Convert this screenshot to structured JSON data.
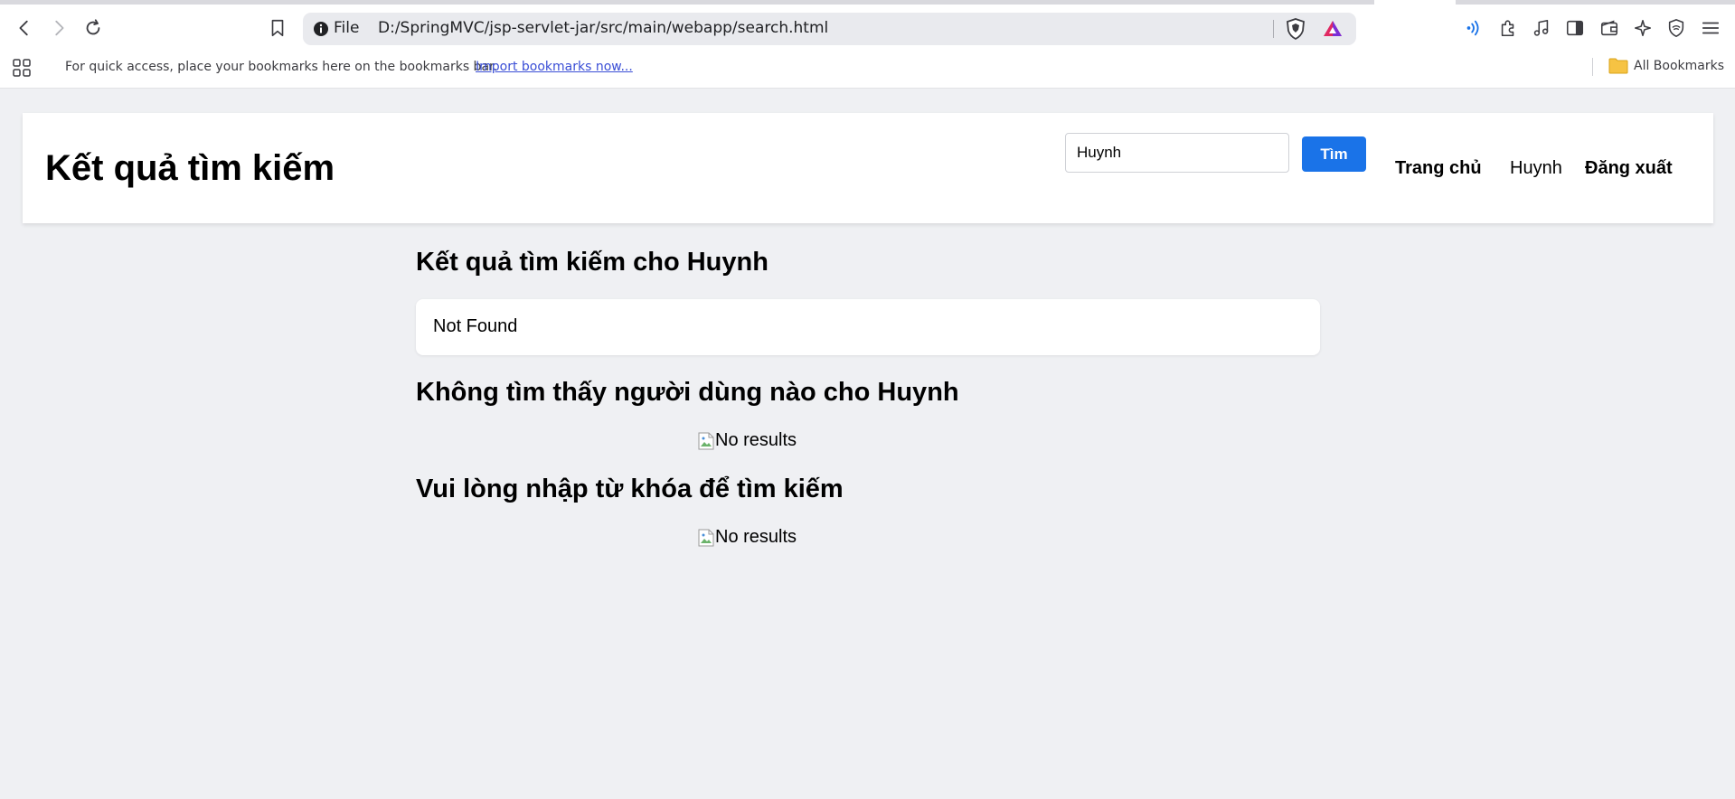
{
  "browser": {
    "url_scheme": "File",
    "url_path": "D:/SpringMVC/jsp-servlet-jar/src/main/webapp/search.html",
    "bookmarks_hint": "For quick access, place your bookmarks here on the bookmarks bar.",
    "import_link": "Import bookmarks now...",
    "all_bookmarks": "All Bookmarks",
    "icons": [
      "back-icon",
      "forward-icon",
      "reload-icon",
      "bookmark-icon",
      "info-icon",
      "brave-shield-icon",
      "rewards-icon",
      "speech-icon",
      "extensions-icon",
      "media-icon",
      "sidebar-icon",
      "wallet-icon",
      "leo-icon",
      "vpn-icon",
      "menu-icon",
      "apps-icon",
      "folder-icon"
    ]
  },
  "header": {
    "title": "Kết quả tìm kiếm",
    "search_value": "Huynh",
    "search_button": "Tìm",
    "nav": {
      "home": "Trang chủ",
      "user": "Huynh",
      "logout": "Đăng xuất"
    }
  },
  "main": {
    "results_heading": "Kết quả tìm kiếm cho Huynh",
    "result_text": "Not Found",
    "no_user_heading": "Không tìm thấy người dùng nào cho Huynh",
    "no_results_alt_1": "No results",
    "enter_keyword_heading": "Vui lòng nhập từ khóa để tìm kiếm",
    "no_results_alt_2": "No results"
  },
  "colors": {
    "accent": "#1a73e8",
    "page_bg": "#eff0f3"
  }
}
